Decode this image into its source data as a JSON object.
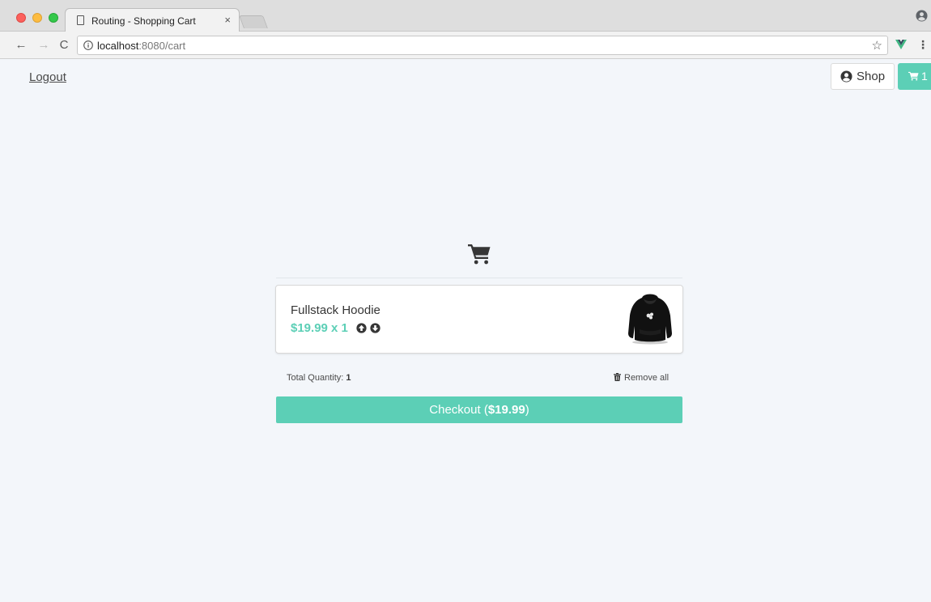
{
  "browser": {
    "tab_title": "Routing - Shopping Cart",
    "tab_close": "×",
    "url_host": "localhost",
    "url_rest": ":8080/cart"
  },
  "icons": {
    "back": "arrow-left-icon",
    "forward": "arrow-right-icon",
    "reload": "reload-icon",
    "star": "star-icon",
    "menu": "kebab-menu-icon"
  },
  "header": {
    "logout_label": "Logout",
    "shop_label": "Shop",
    "cart_count": "1"
  },
  "cart": {
    "item": {
      "name": "Fullstack Hoodie",
      "price_line": "$19.99 x 1"
    },
    "total_quantity_label": "Total Quantity:",
    "total_quantity": "1",
    "remove_all_label": "Remove all",
    "checkout_prefix": "Checkout (",
    "checkout_amount": "$19.99",
    "checkout_suffix": ")"
  },
  "colors": {
    "accent": "#5ccfb6",
    "page_bg": "#f3f6fa"
  }
}
